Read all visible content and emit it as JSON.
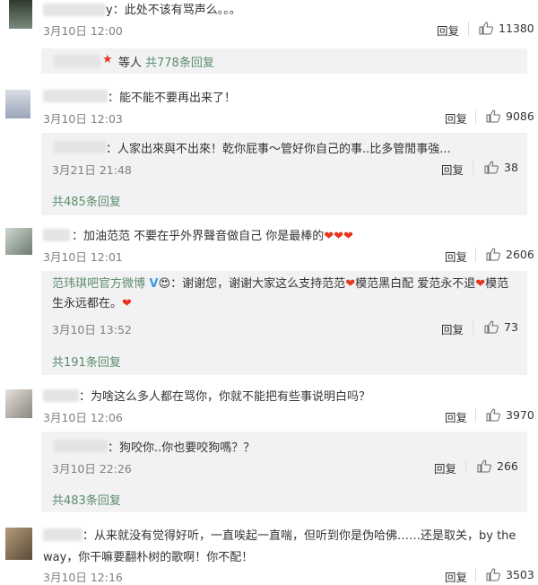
{
  "c1": {
    "text": "y：此处不该有骂声么。。。",
    "time": "3月10日 12:00",
    "reply": "回复",
    "likes": "11380",
    "summary": {
      "suffix": "等人",
      "link": "共778条回复"
    }
  },
  "c2": {
    "text": "：能不能不要再出来了！",
    "time": "3月10日 12:03",
    "reply": "回复",
    "likes": "9086",
    "sub": {
      "text": "：人家出來與不出來！乾你屁事～管好你自己的事..比多管閒事強...",
      "time": "3月21日 21:48",
      "reply": "回复",
      "likes": "38"
    },
    "more": "共485条回复"
  },
  "c3": {
    "text": "：加油范范 不要在乎外界聲音做自己 你是最棒的",
    "hearts": "❤❤❤",
    "time": "3月10日 12:01",
    "reply": "回复",
    "likes": "2606",
    "sub": {
      "author": "范玮琪吧官方微博",
      "text1": "：谢谢您，谢谢大家这么支持范范",
      "text2": "模范黑白配 爱范永不退",
      "text3": "模范",
      "text4": "生永远都在。",
      "time": "3月10日 13:52",
      "reply": "回复",
      "likes": "73"
    },
    "more": "共191条回复"
  },
  "c4": {
    "text": "：为啥这么多人都在骂你，你就不能把有些事说明白吗？",
    "time": "3月10日 12:06",
    "reply": "回复",
    "likes": "3970",
    "sub": {
      "text": "：狗咬你..你也要咬狗嗎？？",
      "time": "3月10日 22:26",
      "reply": "回复",
      "likes": "266"
    },
    "more": "共483条回复"
  },
  "c5": {
    "text1": "：从来就没有觉得好听，一直唉起一直喘，但听到你是伪哈佛……还是取关，by the",
    "text2": "way，你干嘛要翻朴树的歌啊！你不配！",
    "time": "3月10日 12:16",
    "reply": "回复",
    "likes": "3503"
  },
  "colors": {
    "link": "#5b8d6b",
    "heart": "#e8341c",
    "subbg": "#f2f2f5"
  },
  "icons": {
    "like": "thumbs-up-icon",
    "verified": "verified-v-icon",
    "crown": "star-badge-icon"
  }
}
